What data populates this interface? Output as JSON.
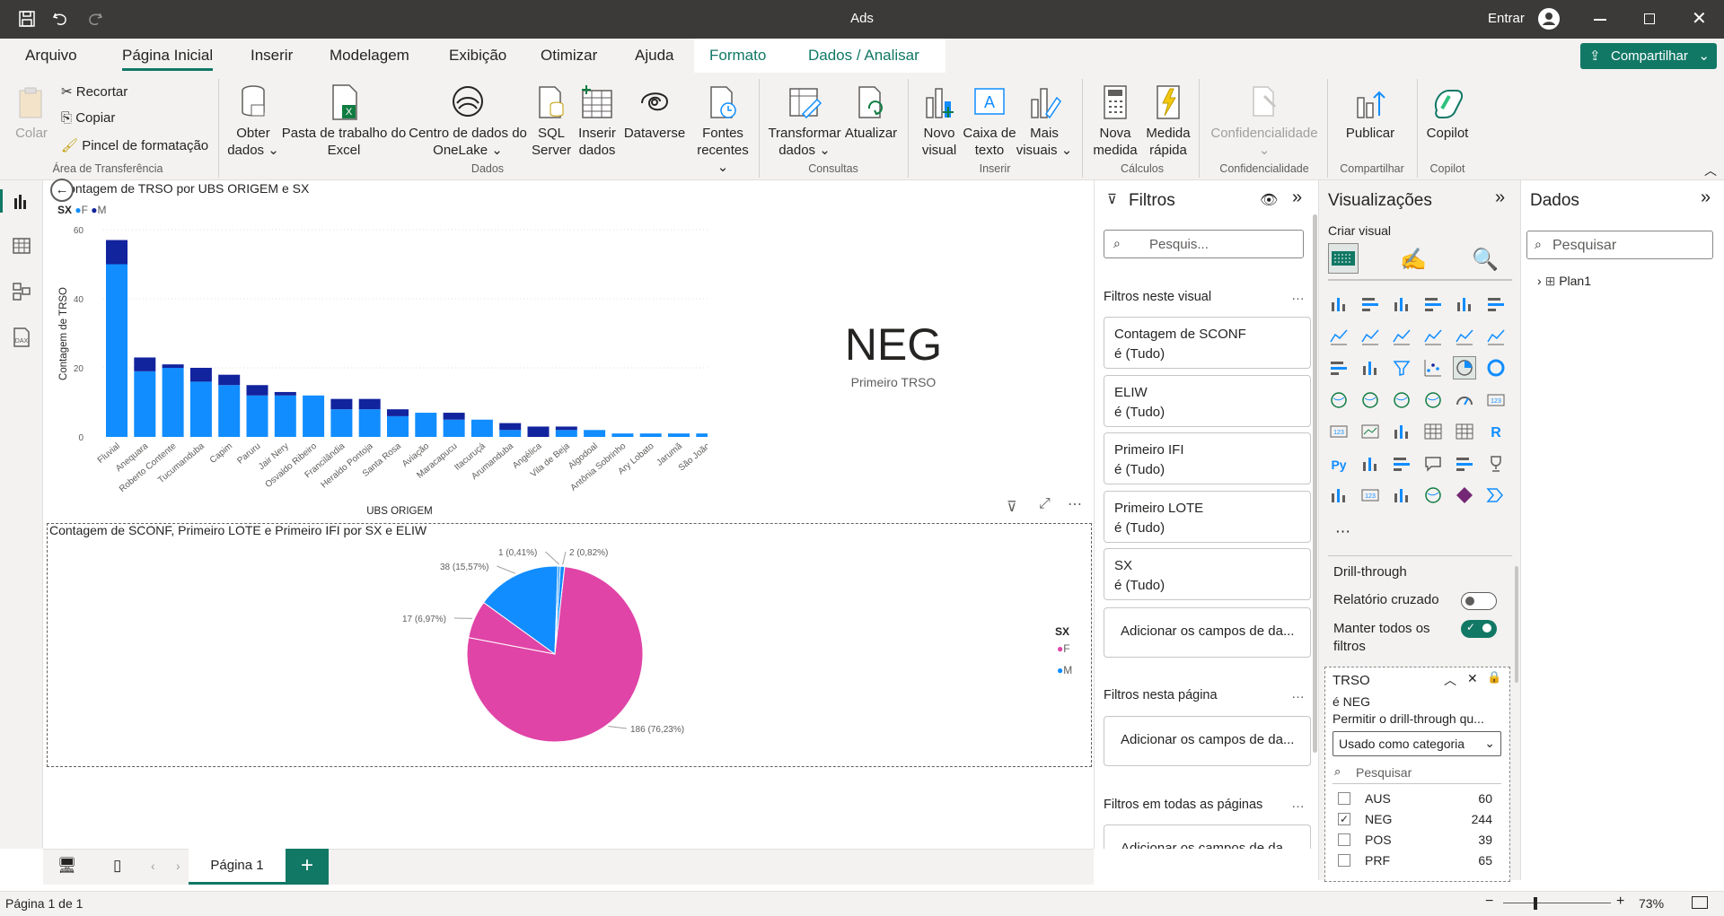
{
  "window": {
    "title": "Ads",
    "signin": "Entrar"
  },
  "menu": {
    "tabs": [
      "Arquivo",
      "Página Inicial",
      "Inserir",
      "Modelagem",
      "Exibição",
      "Otimizar",
      "Ajuda",
      "Formato",
      "Dados / Analisar"
    ],
    "active": "Página Inicial",
    "share": "Compartilhar"
  },
  "ribbon": {
    "paste": "Colar",
    "cut": "Recortar",
    "copy": "Copiar",
    "format_painter": "Pincel de formatação",
    "get_data": [
      "Obter",
      "dados"
    ],
    "excel": [
      "Pasta de trabalho do",
      "Excel"
    ],
    "onelake": [
      "Centro de dados do",
      "OneLake"
    ],
    "sql": [
      "SQL",
      "Server"
    ],
    "enter_data": [
      "Inserir",
      "dados"
    ],
    "dataverse": "Dataverse",
    "recent": [
      "Fontes",
      "recentes"
    ],
    "transform": [
      "Transformar",
      "dados"
    ],
    "refresh": "Atualizar",
    "new_visual": [
      "Novo",
      "visual"
    ],
    "textbox": [
      "Caixa de",
      "texto"
    ],
    "more_visuals": [
      "Mais",
      "visuais"
    ],
    "new_measure": [
      "Nova",
      "medida"
    ],
    "quick_measure": [
      "Medida",
      "rápida"
    ],
    "sensitivity": "Confidencialidade",
    "publish": "Publicar",
    "copilot": "Copilot",
    "groups": {
      "clipboard": "Área de Transferência",
      "data": "Dados",
      "queries": "Consultas",
      "insert": "Inserir",
      "calculations": "Cálculos",
      "sensitivity": "Confidencialidade",
      "share": "Compartilhar",
      "copilot": "Copilot"
    }
  },
  "bar_visual": {
    "title": "Contagem de TRSO por UBS ORIGEM e SX",
    "legend_title": "SX",
    "legend": [
      "F",
      "M"
    ],
    "xlabel": "UBS ORIGEM",
    "ylabel": "Contagem de TRSO",
    "yticks": [
      "60",
      "40",
      "20",
      "0"
    ]
  },
  "card_visual": {
    "value": "NEG",
    "label": "Primeiro TRSO"
  },
  "pie_visual": {
    "title": "Contagem de SCONF, Primeiro LOTE e Primeiro IFI por SX e ELIW",
    "legend_title": "SX",
    "legend": [
      "F",
      "M"
    ],
    "labels": [
      "186 (76,23%)",
      "17 (6,97%)",
      "38 (15,57%)",
      "1 (0,41%)",
      "2 (0,82%)"
    ]
  },
  "filters": {
    "title": "Filtros",
    "search_placeholder": "Pesquis...",
    "section_visual": "Filtros neste visual",
    "cards": [
      {
        "name": "Contagem de SCONF",
        "state": "é (Tudo)"
      },
      {
        "name": "ELIW",
        "state": "é (Tudo)"
      },
      {
        "name": "Primeiro IFI",
        "state": "é (Tudo)"
      },
      {
        "name": "Primeiro LOTE",
        "state": "é (Tudo)"
      },
      {
        "name": "SX",
        "state": "é (Tudo)"
      }
    ],
    "add_fields": "Adicionar os campos de da...",
    "section_page": "Filtros nesta página",
    "section_all": "Filtros em todas as páginas",
    "add_fields_partial": "Adicionar os campos de da..."
  },
  "viz": {
    "title": "Visualizações",
    "build": "Criar visual",
    "drillthrough": "Drill-through",
    "cross_report": "Relatório cruzado",
    "keep_all": [
      "Manter todos os",
      "filtros"
    ],
    "field": "TRSO",
    "field_state": "é NEG",
    "allow": "Permitir o drill-through qu...",
    "used_as": "Usado como categoria",
    "search": "Pesquisar",
    "values": [
      {
        "label": "AUS",
        "count": "60",
        "checked": false
      },
      {
        "label": "NEG",
        "count": "244",
        "checked": true
      },
      {
        "label": "POS",
        "count": "39",
        "checked": false
      },
      {
        "label": "PRF",
        "count": "65",
        "checked": false
      }
    ]
  },
  "data_pane": {
    "title": "Dados",
    "search": "Pesquisar",
    "table": "Plan1"
  },
  "pages": {
    "current": "Página 1"
  },
  "status": {
    "page": "Página 1 de 1",
    "zoom": "73%"
  },
  "colors": {
    "accent": "#117865",
    "series_f": "#118dff",
    "series_m": "#12239e",
    "pie_f": "#e044a7"
  },
  "chart_data": [
    {
      "type": "bar",
      "title": "Contagem de TRSO por UBS ORIGEM e SX",
      "xlabel": "UBS ORIGEM",
      "ylabel": "Contagem de TRSO",
      "ylim": [
        0,
        60
      ],
      "categories": [
        "Fluvial",
        "Anequara",
        "Roberto Contente",
        "Tucumanduba",
        "Capim",
        "Paruru",
        "Jair Nery",
        "Osvaldo Ribeiro",
        "Francilândia",
        "Heraldo Pontoja",
        "Santa Rosa",
        "Aviação",
        "Maracapucu",
        "Itacuruçá",
        "Arumanduba",
        "Angélica",
        "Vila de Beja",
        "Algodoal",
        "Antônia Sobrinho",
        "Ary Lobato",
        "Jarumã",
        "São João"
      ],
      "series": [
        {
          "name": "F",
          "values": [
            50,
            19,
            20,
            16,
            15,
            12,
            12,
            12,
            8,
            8,
            6,
            7,
            5,
            5,
            2,
            0,
            2,
            2,
            1,
            1,
            1,
            1
          ]
        },
        {
          "name": "M",
          "values": [
            7,
            4,
            1,
            4,
            3,
            3,
            1,
            0,
            3,
            3,
            2,
            0,
            2,
            0,
            2,
            3,
            1,
            0,
            0,
            0,
            0,
            0
          ]
        }
      ],
      "grid": true,
      "legend_position": "top-left"
    },
    {
      "type": "pie",
      "title": "Contagem de SCONF, Primeiro LOTE e Primeiro IFI por SX e ELIW",
      "slices": [
        {
          "label": "186 (76,23%)",
          "value": 186,
          "series": "F"
        },
        {
          "label": "17 (6,97%)",
          "value": 17,
          "series": "F"
        },
        {
          "label": "38 (15,57%)",
          "value": 38,
          "series": "M"
        },
        {
          "label": "1 (0,41%)",
          "value": 1,
          "series": "M"
        },
        {
          "label": "2 (0,82%)",
          "value": 2,
          "series": "M"
        }
      ],
      "legend_position": "right"
    }
  ]
}
